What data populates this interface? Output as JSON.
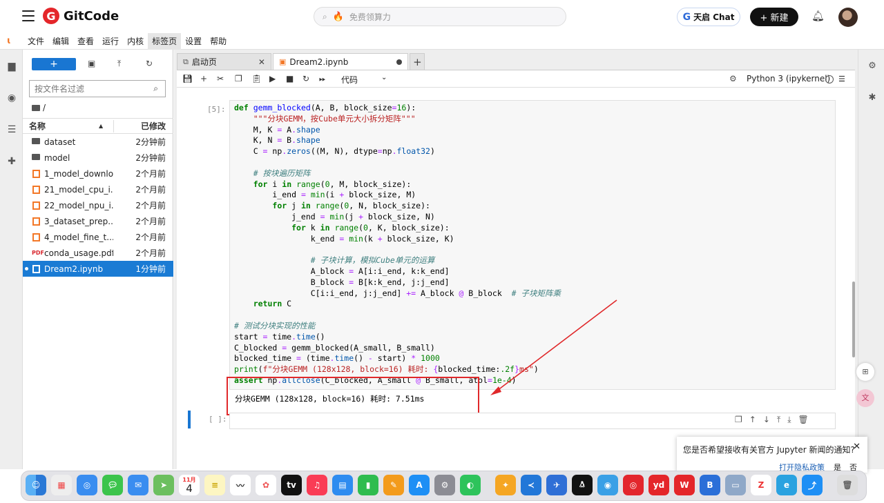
{
  "topbar": {
    "brand": "GitCode",
    "search_placeholder": "免费领算力",
    "chat_label": "天启 Chat",
    "new_label": "+ 新建"
  },
  "menu": [
    "文件",
    "编辑",
    "查看",
    "运行",
    "内核",
    "标签页",
    "设置",
    "帮助"
  ],
  "filebrowser": {
    "new_label": "+",
    "filter_placeholder": "按文件名过滤",
    "crumb": "/",
    "col_name": "名称",
    "col_modified": "已修改",
    "files": [
      {
        "name": "dataset",
        "time": "2分钟前",
        "kind": "folder"
      },
      {
        "name": "model",
        "time": "2分钟前",
        "kind": "folder"
      },
      {
        "name": "1_model_downlo...",
        "time": "2个月前",
        "kind": "notebook"
      },
      {
        "name": "21_model_cpu_i...",
        "time": "2个月前",
        "kind": "notebook"
      },
      {
        "name": "22_model_npu_i...",
        "time": "2个月前",
        "kind": "notebook"
      },
      {
        "name": "3_dataset_prep...",
        "time": "2个月前",
        "kind": "notebook"
      },
      {
        "name": "4_model_fine_t...",
        "time": "2个月前",
        "kind": "notebook"
      },
      {
        "name": "conda_usage.pdf",
        "time": "2个月前",
        "kind": "pdf"
      },
      {
        "name": "Dream2.ipynb",
        "time": "1分钟前",
        "kind": "notebook",
        "selected": true
      }
    ]
  },
  "tabs": [
    {
      "label": "启动页",
      "active": false
    },
    {
      "label": "Dream2.ipynb",
      "active": true
    }
  ],
  "toolbar": {
    "cell_type": "代码",
    "kernel": "Python 3 (ipykernel)"
  },
  "cell": {
    "prompt": "[5]:",
    "output": "分块GEMM (128x128, block=16) 耗时: 7.51ms"
  },
  "empty_cell_prompt": "[ ]:",
  "notification": {
    "text": "您是否希望接收有关官方 Jupyter 新闻的通知?",
    "privacy_label": "打开隐私政策",
    "yes_label": "是",
    "no_label": "否"
  },
  "dock": {
    "calendar_month": "11月",
    "calendar_day": "4"
  },
  "colors": {
    "accent": "#1976d2",
    "jupyter_orange": "#f37726",
    "highlight_red": "#e0282a"
  }
}
